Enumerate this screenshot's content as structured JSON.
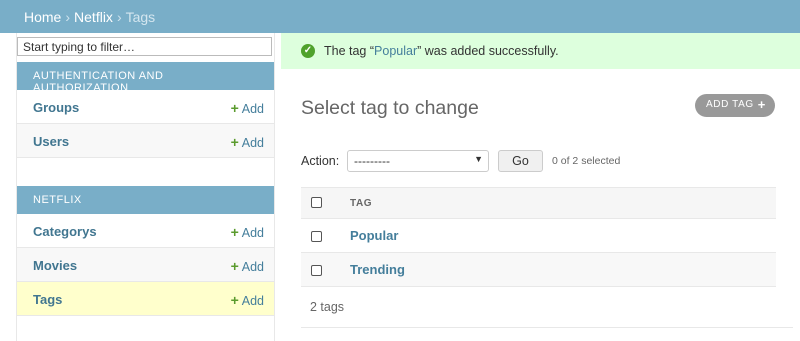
{
  "breadcrumbs": {
    "home": "Home",
    "app": "Netflix",
    "current": "Tags",
    "sep": "›"
  },
  "sidebar": {
    "filter_placeholder": "Start typing to filter…",
    "modules": [
      {
        "caption": "AUTHENTICATION AND AUTHORIZATION",
        "items": [
          {
            "name": "Groups",
            "add": "Add"
          },
          {
            "name": "Users",
            "add": "Add"
          }
        ]
      },
      {
        "caption": "NETFLIX",
        "items": [
          {
            "name": "Categorys",
            "add": "Add"
          },
          {
            "name": "Movies",
            "add": "Add"
          },
          {
            "name": "Tags",
            "add": "Add"
          }
        ]
      }
    ]
  },
  "message": {
    "before": "The tag “",
    "link": "Popular",
    "after": "” was added successfully."
  },
  "title": "Select tag to change",
  "add_button": "ADD TAG",
  "action": {
    "label": "Action:",
    "selected": "---------",
    "go": "Go",
    "count": "0 of 2 selected"
  },
  "table": {
    "header": "TAG",
    "rows": [
      "Popular",
      "Trending"
    ]
  },
  "footer": "2 tags",
  "colors": {
    "header": "#79aec8",
    "link": "#447e9b",
    "success": "#dfd",
    "add_green": "#5b9b2e",
    "selected_row": "#ffffcc"
  }
}
